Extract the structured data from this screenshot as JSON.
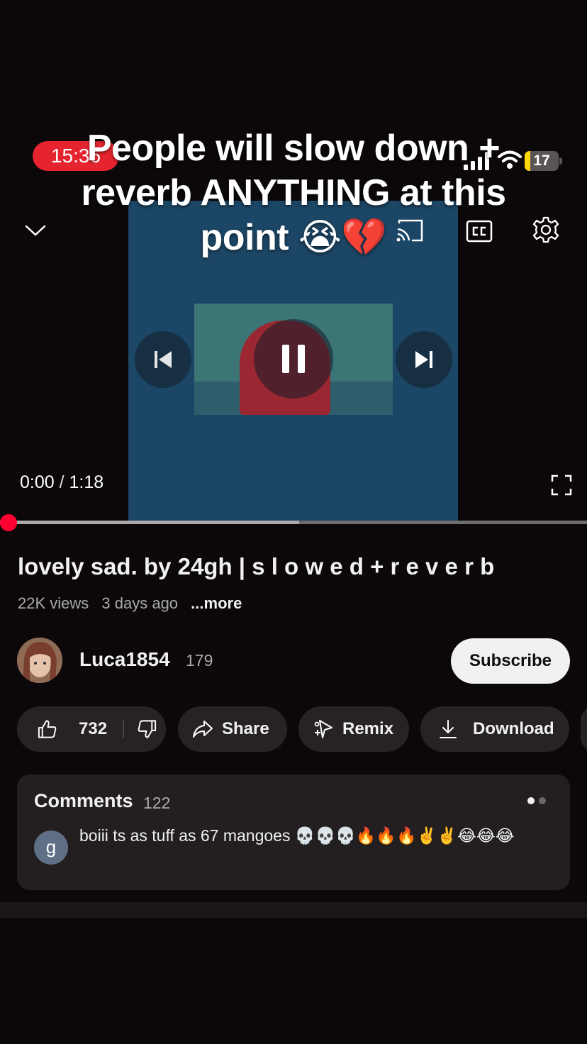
{
  "status_bar": {
    "time": "15:36",
    "battery": "17",
    "battery_level": 0.17
  },
  "overlay_caption": "People will slow down + reverb ANYTHING at this point 😭💔",
  "player": {
    "current_time": "0:00",
    "separator": "/",
    "duration": "1:18",
    "progress": 0.0,
    "buffered": 0.51,
    "icons": [
      "chevron-down-icon",
      "cast-icon",
      "cc-icon",
      "gear-icon",
      "previous-icon",
      "pause-icon",
      "next-icon",
      "fullscreen-icon"
    ]
  },
  "video": {
    "title": "lovely sad. by 24gh | s l o w e d + r e v e r b",
    "views": "22K views",
    "age": "3 days ago",
    "more_label": "...more"
  },
  "channel": {
    "name": "Luca1854",
    "subscribers": "179",
    "subscribe_label": "Subscribe"
  },
  "actions": {
    "likes": "732",
    "share_label": "Share",
    "remix_label": "Remix",
    "download_label": "Download"
  },
  "comments": {
    "title": "Comments",
    "count": "122",
    "top_comment": {
      "avatar_letter": "g",
      "text": "boiii ts as tuff as 67 mangoes 💀💀💀🔥🔥🔥✌️✌️😂😂😂"
    }
  },
  "colors": {
    "accent": "#ff0033",
    "status_pill": "#e5242f",
    "background": "#0c0809",
    "card": "#231f20"
  }
}
